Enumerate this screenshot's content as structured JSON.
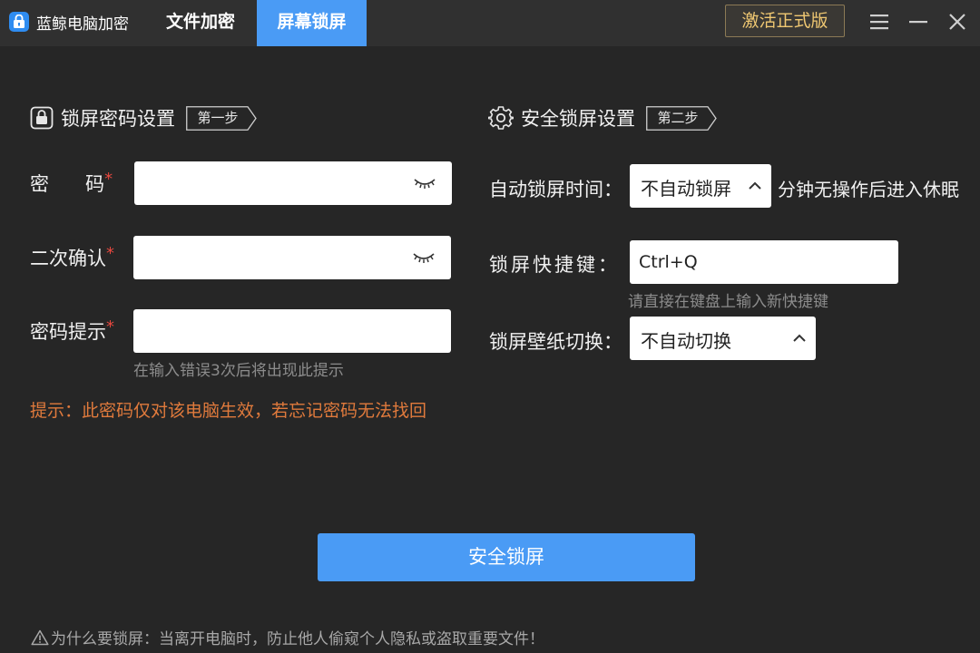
{
  "titlebar": {
    "app_name": "蓝鲸电脑加密",
    "tabs": [
      {
        "label": "文件加密",
        "active": false
      },
      {
        "label": "屏幕锁屏",
        "active": true
      }
    ],
    "activate_label": "激活正式版",
    "icons": [
      "app-logo-icon",
      "menu-icon",
      "minimize-icon",
      "close-icon"
    ],
    "accent_color": "#4a9bf5"
  },
  "left": {
    "title": "锁屏密码设置",
    "step": "第一步",
    "fields": [
      {
        "label": "密      码",
        "required_mark": "*",
        "value": "",
        "icon": "eye-closed-icon"
      },
      {
        "label": "二次确认",
        "required_mark": "*",
        "value": "",
        "icon": "eye-closed-icon"
      },
      {
        "label": "密码提示",
        "required_mark": "*",
        "value": ""
      }
    ],
    "hint_text": "在输入错误3次后将出现此提示",
    "warning": "提示：此密码仅对该电脑生效，若忘记密码无法找回"
  },
  "right": {
    "title": "安全锁屏设置",
    "step": "第二步",
    "auto_lock": {
      "label": "自动锁屏时间：",
      "selected": "不自动锁屏",
      "suffix": "分钟无操作后进入休眠"
    },
    "hotkey": {
      "label": "锁屏快捷键：",
      "value": "Ctrl+Q",
      "hint": "请直接在键盘上输入新快捷键"
    },
    "wallpaper": {
      "label": "锁屏壁纸切换：",
      "selected": "不自动切换"
    }
  },
  "action": {
    "label": "安全锁屏"
  },
  "footer": {
    "text": "为什么要锁屏：当离开电脑时，防止他人偷窥个人隐私或盗取重要文件！"
  }
}
